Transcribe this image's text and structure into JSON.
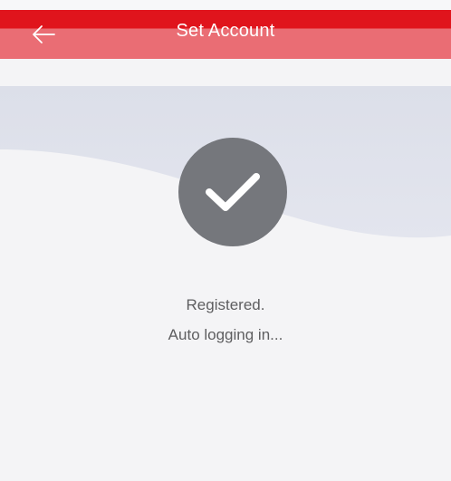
{
  "header": {
    "title": "Set Account",
    "back_icon": "arrow-left-icon"
  },
  "status": {
    "icon": "checkmark-icon",
    "line1": "Registered.",
    "line2": "Auto logging in..."
  },
  "colors": {
    "nav_red": "#e0141c",
    "nav_pink": "#ea6d74",
    "circle_gray": "#75777c",
    "background": "#f4f4f6",
    "wave": "#dde0ea"
  }
}
